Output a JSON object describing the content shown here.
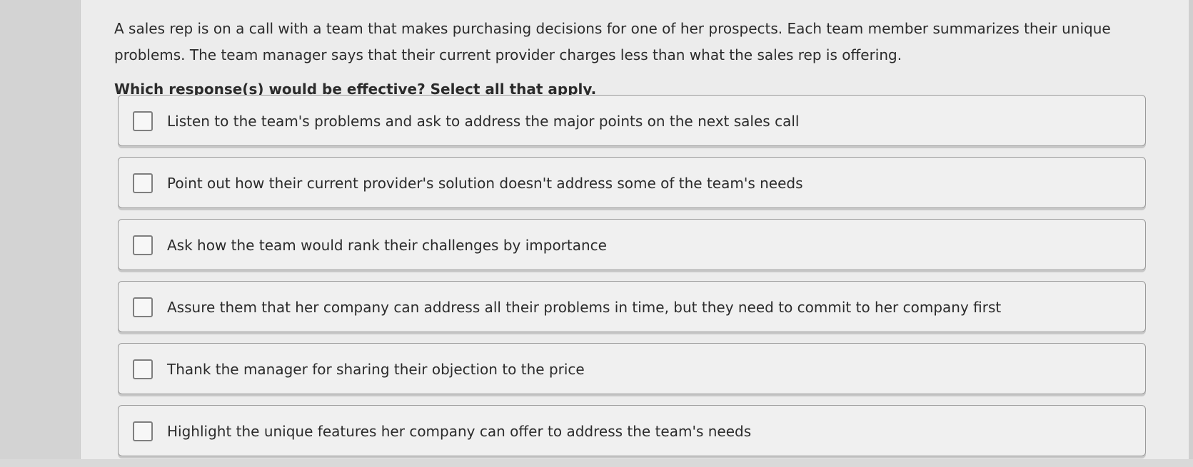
{
  "question": "A sales rep is on a call with a team that makes purchasing decisions for one of her prospects. Each team member summarizes their unique problems. The team manager says that their current provider charges less than what the sales rep is offering.",
  "prompt": "Which response(s) would be effective? Select all that apply.",
  "options": [
    {
      "label": "Listen to the team's problems and ask to address the major points on the next sales call"
    },
    {
      "label": "Point out how their current provider's solution doesn't address some of the team's needs"
    },
    {
      "label": "Ask how the team would rank their challenges by importance"
    },
    {
      "label": "Assure them that her company can address all their problems in time, but they need to commit to her company first"
    },
    {
      "label": "Thank the manager for sharing their objection to the price"
    },
    {
      "label": "Highlight the unique features her company can offer to address the team's needs"
    }
  ]
}
